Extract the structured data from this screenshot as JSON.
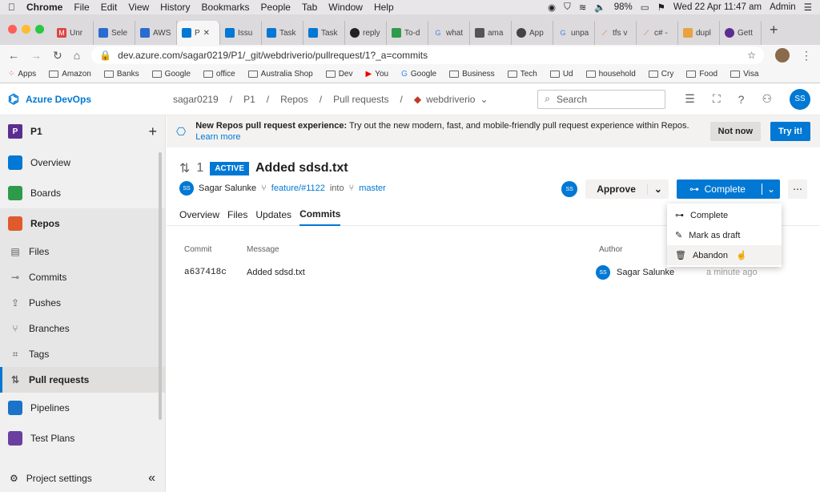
{
  "macbar": {
    "app": "Chrome",
    "menus": [
      "File",
      "Edit",
      "View",
      "History",
      "Bookmarks",
      "People",
      "Tab",
      "Window",
      "Help"
    ],
    "battery": "98%",
    "datetime": "Wed 22 Apr  11:47 am",
    "user": "Admin"
  },
  "tabs": [
    {
      "label": "Unr"
    },
    {
      "label": "Sele"
    },
    {
      "label": "AWS"
    },
    {
      "label": "P"
    },
    {
      "label": "Issu"
    },
    {
      "label": "Task"
    },
    {
      "label": "Task"
    },
    {
      "label": "reply"
    },
    {
      "label": "To-d"
    },
    {
      "label": "what"
    },
    {
      "label": "ama"
    },
    {
      "label": "App"
    },
    {
      "label": "unpa"
    },
    {
      "label": "tfs v"
    },
    {
      "label": "c# -"
    },
    {
      "label": "dupl"
    },
    {
      "label": "Gett"
    }
  ],
  "address": {
    "url": "dev.azure.com/sagar0219/P1/_git/webdriverio/pullrequest/1?_a=commits"
  },
  "bookmarks": [
    "Apps",
    "Amazon",
    "Banks",
    "Google",
    "office",
    "Australia Shop",
    "Dev",
    "You",
    "Google",
    "Business",
    "Tech",
    "Ud",
    "household",
    "Cry",
    "Food",
    "Visa"
  ],
  "ado": {
    "product": "Azure DevOps",
    "crumbs": [
      "sagar0219",
      "/",
      "P1",
      "/",
      "Repos",
      "/",
      "Pull requests",
      "/"
    ],
    "repo": "webdriverio",
    "search_placeholder": "Search",
    "avatar": "SS"
  },
  "sidebar": {
    "project": "P1",
    "project_initial": "P",
    "items": [
      {
        "label": "Overview"
      },
      {
        "label": "Boards"
      },
      {
        "label": "Repos"
      }
    ],
    "repos_sub": [
      {
        "label": "Files"
      },
      {
        "label": "Commits"
      },
      {
        "label": "Pushes"
      },
      {
        "label": "Branches"
      },
      {
        "label": "Tags"
      },
      {
        "label": "Pull requests"
      }
    ],
    "items2": [
      {
        "label": "Pipelines"
      },
      {
        "label": "Test Plans"
      }
    ],
    "settings": "Project settings"
  },
  "banner": {
    "bold": "New Repos pull request experience:",
    "text": " Try out the new modern, fast, and mobile-friendly pull request experience within Repos. ",
    "link": "Learn more",
    "not_now": "Not now",
    "try": "Try it!"
  },
  "pr": {
    "number": "1",
    "status": "ACTIVE",
    "title": "Added sdsd.txt",
    "author": "Sagar Salunke",
    "author_initials": "SS",
    "source": "feature/#1122",
    "into": "into",
    "target": "master",
    "approve": "Approve",
    "complete": "Complete",
    "tabs": [
      "Overview",
      "Files",
      "Updates",
      "Commits"
    ]
  },
  "commits": {
    "headers": {
      "commit": "Commit",
      "message": "Message",
      "author": "Author"
    },
    "rows": [
      {
        "hash": "a637418c",
        "message": "Added sdsd.txt",
        "author": "Sagar Salunke",
        "time": "a minute ago"
      }
    ]
  },
  "menu": {
    "items": [
      "Complete",
      "Mark as draft",
      "Abandon"
    ]
  }
}
